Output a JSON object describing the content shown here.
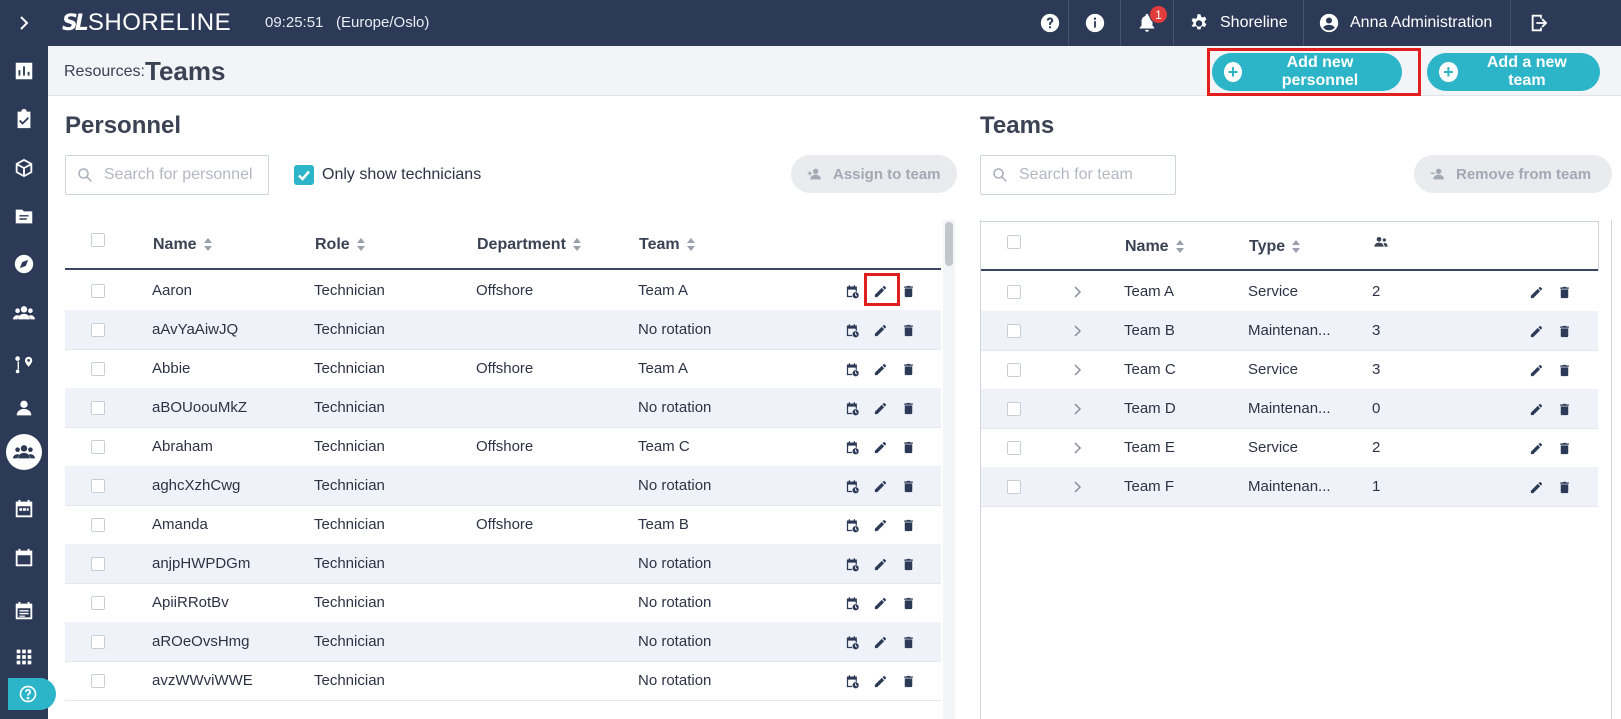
{
  "topbar": {
    "logo_mark": "SL",
    "logo_text": "SHORELINE",
    "clock": "09:25:51",
    "timezone": "(Europe/Oslo)",
    "notification_count": "1",
    "org_label": "Shoreline",
    "user_label": "Anna Administration"
  },
  "header": {
    "breadcrumb": "Resources:",
    "title": "Teams",
    "add_personnel_label": "Add new personnel",
    "add_team_label": "Add a new team"
  },
  "personnel": {
    "title": "Personnel",
    "search_placeholder": "Search for personnel",
    "only_technicians_label": "Only show technicians",
    "assign_label": "Assign to team",
    "columns": [
      "Name",
      "Role",
      "Department",
      "Team"
    ],
    "rows": [
      {
        "name": "Aaron",
        "role": "Technician",
        "department": "Offshore",
        "team": "Team A"
      },
      {
        "name": "aAvYaAiwJQ",
        "role": "Technician",
        "department": "",
        "team": "No rotation"
      },
      {
        "name": "Abbie",
        "role": "Technician",
        "department": "Offshore",
        "team": "Team A"
      },
      {
        "name": "aBOUoouMkZ",
        "role": "Technician",
        "department": "",
        "team": "No rotation"
      },
      {
        "name": "Abraham",
        "role": "Technician",
        "department": "Offshore",
        "team": "Team C"
      },
      {
        "name": "aghcXzhCwg",
        "role": "Technician",
        "department": "",
        "team": "No rotation"
      },
      {
        "name": "Amanda",
        "role": "Technician",
        "department": "Offshore",
        "team": "Team B"
      },
      {
        "name": "anjpHWPDGm",
        "role": "Technician",
        "department": "",
        "team": "No rotation"
      },
      {
        "name": "ApiiRRotBv",
        "role": "Technician",
        "department": "",
        "team": "No rotation"
      },
      {
        "name": "aROeOvsHmg",
        "role": "Technician",
        "department": "",
        "team": "No rotation"
      },
      {
        "name": "avzWWviWWE",
        "role": "Technician",
        "department": "",
        "team": "No rotation"
      }
    ]
  },
  "teams": {
    "title": "Teams",
    "search_placeholder": "Search for team",
    "remove_label": "Remove from team",
    "columns": [
      "Name",
      "Type"
    ],
    "rows": [
      {
        "name": "Team A",
        "type": "Service",
        "count": "2"
      },
      {
        "name": "Team B",
        "type": "Maintenan...",
        "count": "3"
      },
      {
        "name": "Team C",
        "type": "Service",
        "count": "3"
      },
      {
        "name": "Team D",
        "type": "Maintenan...",
        "count": "0"
      },
      {
        "name": "Team E",
        "type": "Service",
        "count": "2"
      },
      {
        "name": "Team F",
        "type": "Maintenan...",
        "count": "1"
      }
    ]
  },
  "colors": {
    "nav_bg": "#2c3a57",
    "accent": "#2cb5c8",
    "highlight": "#e21f1f",
    "row_alt": "#eff2f8"
  },
  "icons": {
    "sidebar": [
      "chevron-right-icon",
      "dashboard-icon",
      "tasks-icon",
      "box-icon",
      "documents-icon",
      "compass-icon",
      "people-icon",
      "route-icon",
      "person-icon",
      "teams-icon",
      "schedule-icon",
      "calendar-icon",
      "reports-icon",
      "apps-icon",
      "help-icon"
    ],
    "row_actions": [
      "calendar-clock-icon",
      "edit-icon",
      "delete-icon"
    ]
  }
}
